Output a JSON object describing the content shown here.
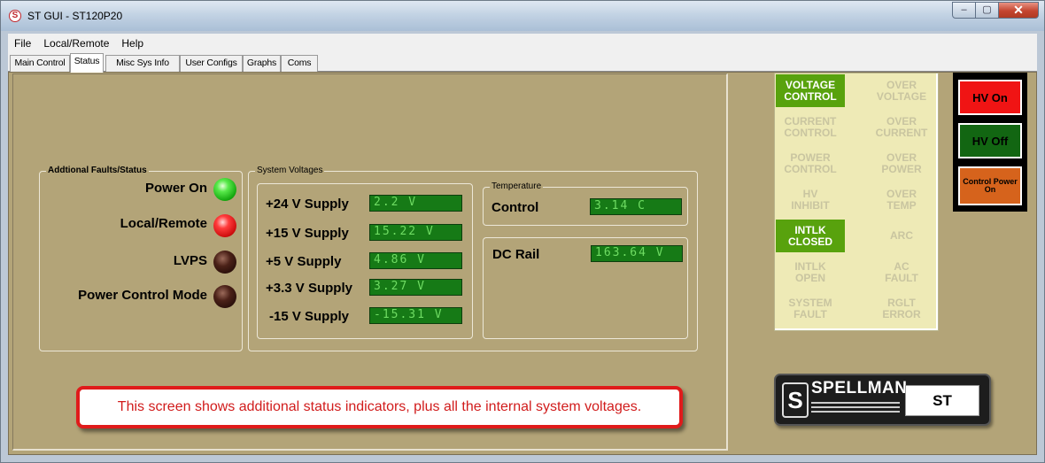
{
  "window": {
    "title": "ST GUI - ST120P20",
    "app_icon": "spellman-s-icon",
    "app_icon_glyph": "S",
    "minimize_glyph": "–",
    "maximize_glyph": "▢",
    "close_glyph": "✕"
  },
  "menu": [
    "File",
    "Local/Remote",
    "Help"
  ],
  "tabs": [
    "Main Control",
    "Status",
    "Misc Sys Info",
    "User Configs",
    "Graphs",
    "Coms"
  ],
  "active_tab": "Status",
  "faults": {
    "title": "Addtional Faults/Status",
    "items": [
      {
        "label": "Power On",
        "led": "green"
      },
      {
        "label": "Local/Remote",
        "led": "red"
      },
      {
        "label": "LVPS",
        "led": "off"
      },
      {
        "label": "Power Control Mode",
        "led": "off"
      }
    ]
  },
  "voltages": {
    "title": "System Voltages",
    "items": [
      {
        "label": "+24 V Supply",
        "value": "2.2 V"
      },
      {
        "label": "+15 V Supply",
        "value": "15.22 V"
      },
      {
        "label": "+5 V Supply",
        "value": "4.86 V"
      },
      {
        "label": "+3.3 V Supply",
        "value": "3.27 V"
      },
      {
        "label": "-15 V Supply",
        "value": "-15.31 V"
      }
    ]
  },
  "temperature": {
    "title": "Temperature",
    "label": "Control",
    "value": "3.14 C"
  },
  "dc_rail": {
    "label": "DC Rail",
    "value": "163.64 V"
  },
  "callout": "This screen shows additional status indicators, plus all the internal system voltages.",
  "indicators": [
    {
      "label": "VOLTAGE\nCONTROL",
      "active": true
    },
    {
      "label": "OVER\nVOLTAGE",
      "active": false
    },
    {
      "label": "CURRENT\nCONTROL",
      "active": false
    },
    {
      "label": "OVER\nCURRENT",
      "active": false
    },
    {
      "label": "POWER\nCONTROL",
      "active": false
    },
    {
      "label": "OVER\nPOWER",
      "active": false
    },
    {
      "label": "HV\nINHIBIT",
      "active": false
    },
    {
      "label": "OVER\nTEMP",
      "active": false
    },
    {
      "label": "INTLK\nCLOSED",
      "active": true
    },
    {
      "label": "ARC",
      "active": false
    },
    {
      "label": "INTLK\nOPEN",
      "active": false
    },
    {
      "label": "AC\nFAULT",
      "active": false
    },
    {
      "label": "SYSTEM\nFAULT",
      "active": false
    },
    {
      "label": "RGLT\nERROR",
      "active": false
    }
  ],
  "hv": {
    "on_label": "HV On",
    "off_label": "HV Off",
    "control_power_label": "Control Power On"
  },
  "colors": {
    "panel": "#b3a478",
    "lcd_bg": "#167a16",
    "lcd_text": "#6fdc63",
    "indicator_on": "#58a20d",
    "hv_on": "#f01414",
    "hv_off": "#126612",
    "control_power": "#d6631c",
    "callout_border": "#e01b1b"
  },
  "logo": {
    "brand": "SPELLMAN",
    "model": "ST",
    "s_glyph": "S"
  }
}
